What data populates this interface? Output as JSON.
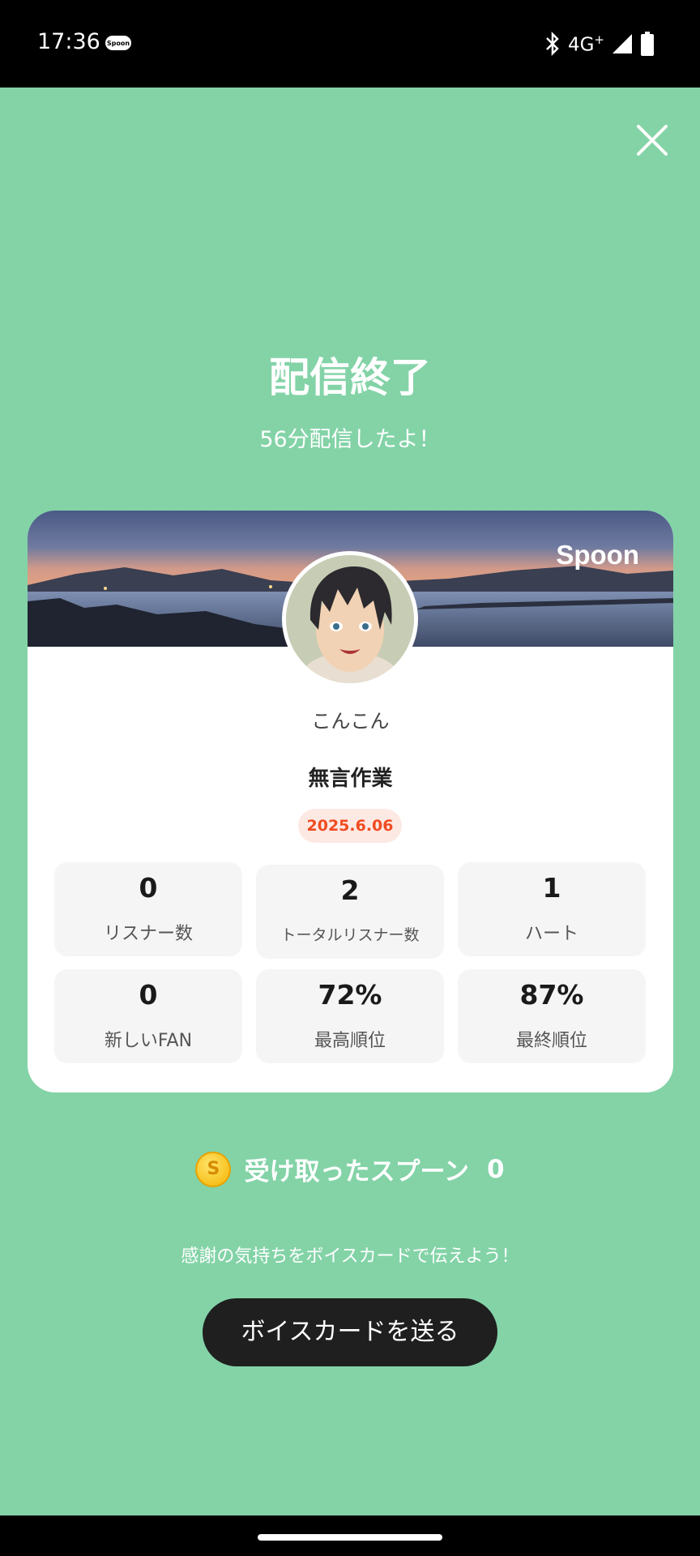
{
  "status_bar": {
    "time": "17:36",
    "app_badge": "Spoon",
    "network": "4G",
    "network_plus": "+"
  },
  "header": {
    "title": "配信終了",
    "subtitle": "56分配信したよ！"
  },
  "card": {
    "brand": "Spoon",
    "username": "こんこん",
    "broadcast_title": "無言作業",
    "date": "2025.6.06",
    "stats": [
      {
        "value": "0",
        "label": "リスナー数"
      },
      {
        "value": "2",
        "label": "トータルリスナー数"
      },
      {
        "value": "1",
        "label": "ハート"
      },
      {
        "value": "0",
        "label": "新しいFAN"
      },
      {
        "value": "72%",
        "label": "最高順位"
      },
      {
        "value": "87%",
        "label": "最終順位"
      }
    ]
  },
  "spoons": {
    "coin_symbol": "S",
    "label": "受け取ったスプーン",
    "count": "0"
  },
  "footer": {
    "message": "感謝の気持ちをボイスカードで伝えよう！",
    "voice_card_button": "ボイスカードを送る"
  },
  "colors": {
    "background": "#83d3a7",
    "date_text": "#f04b22",
    "date_bg": "#fde9e3",
    "button_bg": "#1f1f1f"
  }
}
